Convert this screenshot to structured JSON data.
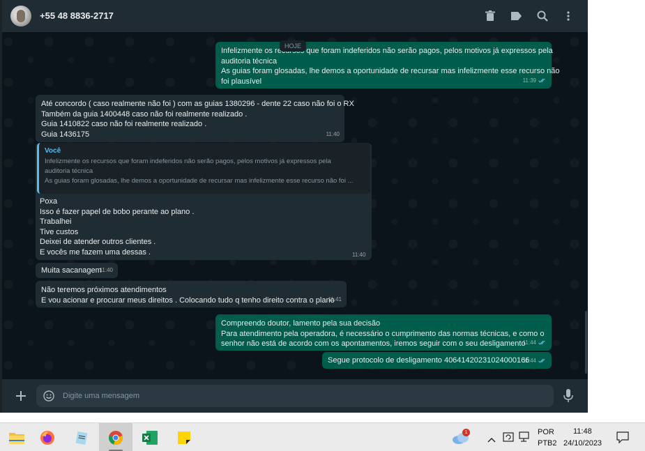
{
  "header": {
    "contact_name": "+55 48 8836-2717",
    "icons": [
      "delete-icon",
      "label-icon",
      "search-icon",
      "more-options-icon"
    ]
  },
  "date_chip": "HOJE",
  "messages": [
    {
      "id": "m1",
      "direction": "out",
      "lines": [
        "Infelizmente os recursos que foram indeferidos não serão pagos, pelos motivos já expressos pela",
        "auditoria técnica",
        "As guias foram glosadas, lhe demos a oportunidade de recursar mas infelizmente esse recurso não",
        "foi plausível"
      ],
      "time": "11:39",
      "status": "read"
    },
    {
      "id": "m2",
      "direction": "in",
      "lines": [
        "Até concordo ( caso realmente não foi ) com as guias 1380296 - dente 22 caso não foi o RX",
        "Também da guia 1400448 caso não foi realmente realizado .",
        "Guia 1410822 caso não foi realmente realizado .",
        "Guia 1436175"
      ],
      "time": "11:40"
    },
    {
      "id": "m3",
      "direction": "in",
      "quote": {
        "author": "Você",
        "lines": [
          "Infelizmente os recursos que foram indeferidos não serão pagos, pelos motivos já expressos pela",
          "auditoria técnica",
          "As guias foram glosadas, lhe demos a oportunidade de recursar mas infelizmente esse recurso não foi ..."
        ]
      },
      "lines": [
        "Poxa",
        "Isso é fazer papel de bobo perante ao plano .",
        "Trabalhei",
        "Tive custos",
        "Deixei de atender outros clientes .",
        "E vocês me fazem uma dessas ."
      ],
      "time": "11:40"
    },
    {
      "id": "m4",
      "direction": "in",
      "lines": [
        "Muita sacanagem"
      ],
      "time": "11:40"
    },
    {
      "id": "m5",
      "direction": "in",
      "lines": [
        "Não teremos próximos atendimentos",
        "E vou acionar e procurar meus direitos . Colocando tudo q tenho direito contra o plano"
      ],
      "time": "11:41"
    },
    {
      "id": "m6",
      "direction": "out",
      "lines": [
        "Compreendo doutor, lamento pela sua decisão",
        "Para atendimento pela operadora, é necessário o cumprimento das normas técnicas, e como o",
        "senhor não está de acordo com os apontamentos, iremos seguir com o seu desligamento"
      ],
      "time": "11:44",
      "status": "read"
    },
    {
      "id": "m7",
      "direction": "out",
      "lines": [
        "Segue protocolo de desligamento 40641420231024000166"
      ],
      "time": "11:44",
      "status": "read"
    }
  ],
  "composer": {
    "placeholder": "Digite uma mensagem",
    "icons": [
      "plus-icon",
      "emoji-icon",
      "microphone-icon"
    ]
  },
  "taskbar": {
    "apps": [
      {
        "name": "file-explorer",
        "active": false
      },
      {
        "name": "firefox",
        "active": false
      },
      {
        "name": "notepad",
        "active": false
      },
      {
        "name": "chrome",
        "active": true
      },
      {
        "name": "excel",
        "active": false
      },
      {
        "name": "sticky-notes",
        "active": false
      }
    ],
    "weather_badge": "1",
    "language": "POR",
    "keyboard": "PTB2",
    "time": "11:48",
    "date": "24/10/2023"
  },
  "colors": {
    "chat_bg": "#0b141a",
    "header_bg": "#202c33",
    "incoming_bubble": "#202c33",
    "outgoing_bubble": "#005c4b",
    "text": "#e9edef",
    "read_ticks": "#53bdeb",
    "taskbar_bg": "#ebebeb"
  }
}
